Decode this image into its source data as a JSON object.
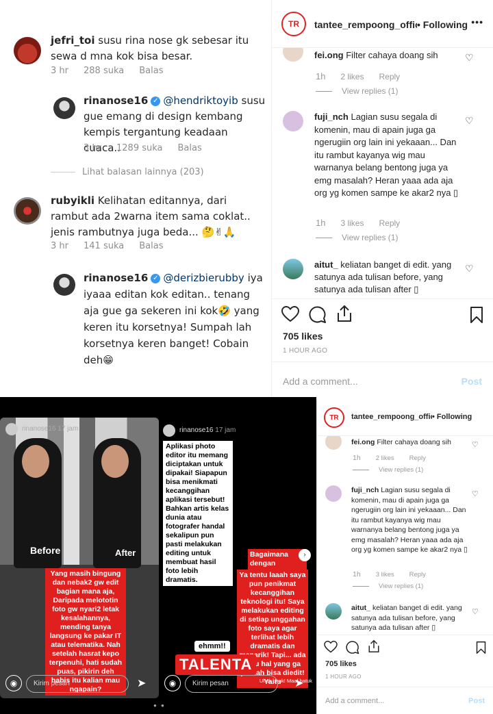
{
  "comments_top": [
    {
      "user": "jefri_toi",
      "text": "susu rina nose gk sebesar itu sewa d mna kok bisa besar.",
      "time": "3 hr",
      "likes": "288 suka",
      "reply": "Balas"
    },
    {
      "user": "rinanose16",
      "mention": "@hendriktoyib",
      "text": "susu gue emang di design kembang kempis tergantung keadaan cuaca..",
      "time": "3 hr",
      "likes": "1289 suka",
      "reply": "Balas"
    },
    {
      "view_more": "Lihat balasan lainnya (203)"
    },
    {
      "user": "rubyikli",
      "text": "Kelihatan editannya, dari rambut ada 2warna item sama coklat.. jenis rambutnya juga beda... 🤔✌🙏",
      "time": "3 hr",
      "likes": "141 suka",
      "reply": "Balas"
    },
    {
      "user": "rinanose16",
      "mention": "@derizbierubby",
      "text": "iya iyaaa editan kok editan.. tenang aja gue ga sekeren ini kok🤣 yang keren itu korsetnya! Sumpah lah korsetnya keren banget! Cobain deh😁"
    }
  ],
  "ig": {
    "username": "tantee_rempoong_offic",
    "following": "• Following",
    "more": "•••",
    "logo_text": "TR",
    "comments": [
      {
        "user": "fei.ong",
        "text": "Filter cahaya doang sih",
        "time": "1h",
        "likes": "2 likes",
        "reply": "Reply",
        "replies": "View replies (1)"
      },
      {
        "user": "fuji_nch",
        "text": "Lagian susu segala di komenin, mau di apain juga ga ngerugiin org lain ini yekaaan... Dan itu rambut kayanya wig mau warnanya belang bentong juga ya emg masalah? Heran yaaa ada aja org yg komen sampe ke akar2 nya ▯",
        "time": "1h",
        "likes": "3 likes",
        "reply": "Reply",
        "replies": "View replies (1)"
      },
      {
        "user": "aitut_",
        "text": "keliatan banget di edit. yang satunya ada tulisan before, yang satunya ada tulisan after ▯"
      }
    ],
    "likes": "705 likes",
    "posted": "1 HOUR AGO",
    "add_comment": "Add a comment...",
    "post": "Post"
  },
  "story_left": {
    "username": "rinanose16",
    "time": "17 jam",
    "before": "Before",
    "after": "After",
    "red_text": "Yang masih bingung dan nebak2 gw edit bagian mana aja, Daripada melototin foto gw nyari2 letak kesalahannya, mending tanya langsung ke pakar IT atau telematika. Nah setelah hasrat kepo terpenuhi, hati sudah puas, pikirin deh habis itu kalian mau ngapain?",
    "message_placeholder": "Kirim pesan"
  },
  "story_right": {
    "username": "rinanose16",
    "time": "17 jam",
    "white_text": "Aplikasi photo editor itu memang diciptakan untuk dipakai! Siapapun bisa menikmati kecanggihan aplikasi tersebut! Bahkan artis kelas dunia atau fotografer handal sekalipun pun pasti melakukan editing untuk membuat hasil foto lebih dramatis.",
    "red_q": "Bagaimana dengan saya????",
    "red_text": "Ya tentu laaah saya pun penikmat kecanggihan teknologi itu! Saya melakukan editing di setiap unggahan foto saya agar terlihat lebih dramatis dan menarik! Tapi... ada satu hal yang ga pernah bisa diedit! Yaitu",
    "ehmm": "ehmm!!",
    "talenta": "TALENTA",
    "uhuk": "Uhuk uhuk! Maaf batuk",
    "message_placeholder": "Kirim pesan"
  }
}
